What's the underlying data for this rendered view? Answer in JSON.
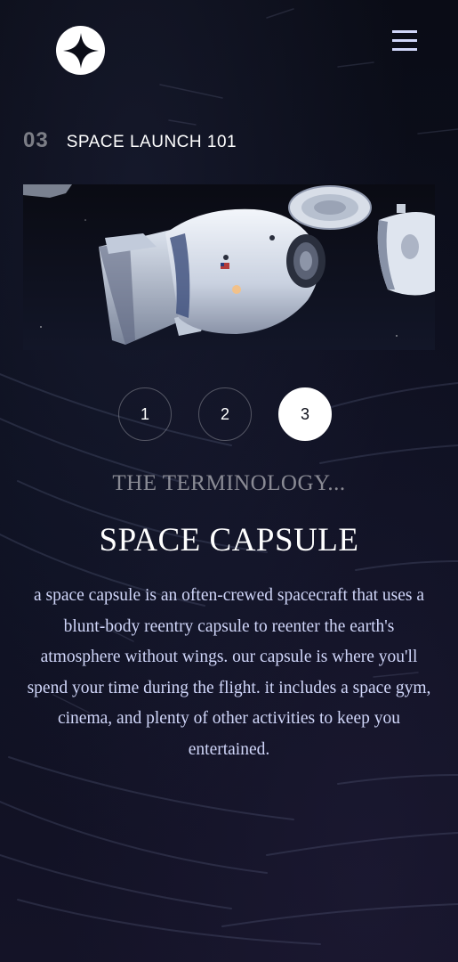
{
  "header": {
    "logo_icon": "star-logo-icon",
    "menu_icon": "hamburger-menu-icon"
  },
  "page": {
    "number": "03",
    "title": "SPACE LAUNCH 101"
  },
  "carousel": {
    "items": [
      {
        "label": "1"
      },
      {
        "label": "2"
      },
      {
        "label": "3"
      }
    ],
    "active": "3"
  },
  "technology": {
    "label": "THE TERMINOLOGY...",
    "name": "SPACE CAPSULE",
    "description": "a space capsule is an often-crewed spacecraft that uses a blunt-body reentry capsule to reenter the earth's atmosphere without wings. our capsule is where you'll spend your time during the flight. it includes a space gym, cinema, and plenty of other activities to keep you entertained."
  },
  "colors": {
    "background": "#0b0d17",
    "accent_light": "#d0d6f9",
    "white": "#ffffff"
  }
}
